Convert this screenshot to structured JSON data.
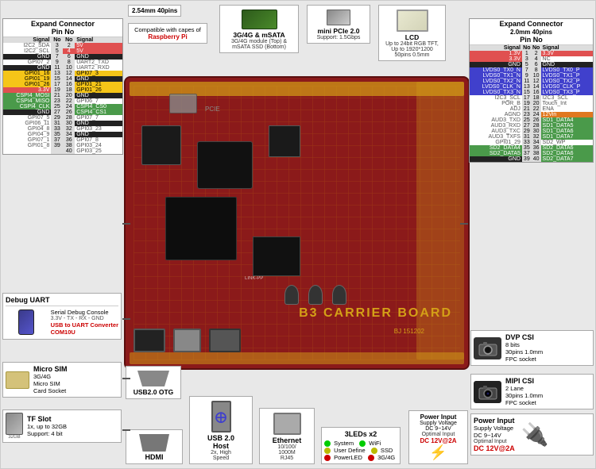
{
  "title": "B3 Carrier Board",
  "left_connector": {
    "title": "Expand Connector",
    "subtitle": "Pin No",
    "note": "2.54mm 40pins",
    "headers": [
      "",
      "",
      "",
      ""
    ],
    "pins": [
      {
        "left_signal": "I2C2_SDA",
        "left_num": "3",
        "right_num": "2",
        "right_signal": "5V",
        "left_color": "none",
        "right_color": "red"
      },
      {
        "left_signal": "I2C2_SCL",
        "left_num": "5",
        "right_num": "4",
        "right_signal": "5V",
        "left_color": "none",
        "right_color": "red"
      },
      {
        "left_signal": "GND",
        "left_num": "7",
        "right_num": "6",
        "right_signal": "GND",
        "left_color": "black",
        "right_color": "black"
      },
      {
        "left_signal": "GPI07_2",
        "left_num": "9",
        "right_num": "8",
        "right_signal": "UART2_TXD",
        "left_color": "none",
        "right_color": "none"
      },
      {
        "left_signal": "GND",
        "left_num": "11",
        "right_num": "10",
        "right_signal": "UART2_RXD",
        "left_color": "black",
        "right_color": "none"
      },
      {
        "left_signal": "GPI01_16",
        "left_num": "13",
        "right_num": "12",
        "right_signal": "GPI07_3",
        "left_color": "yellow",
        "right_color": "yellow"
      },
      {
        "left_signal": "GPI01_19",
        "left_num": "15",
        "right_num": "14",
        "right_signal": "GND",
        "left_color": "yellow",
        "right_color": "black"
      },
      {
        "left_signal": "GPI01_26",
        "left_num": "17",
        "right_num": "16",
        "right_signal": "GPI01_21",
        "left_color": "yellow",
        "right_color": "yellow"
      },
      {
        "left_signal": "3.3V",
        "left_num": "19",
        "right_num": "18",
        "right_signal": "GPI01_26",
        "left_color": "red",
        "right_color": "yellow"
      },
      {
        "left_signal": "CSPI4_MOSI",
        "left_num": "21",
        "right_num": "20",
        "right_signal": "GND",
        "left_color": "green",
        "right_color": "black"
      },
      {
        "left_signal": "CSPI4_MISO",
        "left_num": "23",
        "right_num": "22",
        "right_signal": "GPI06_7",
        "left_color": "green",
        "right_color": "none"
      },
      {
        "left_signal": "CSPI4_CLK",
        "left_num": "25",
        "right_num": "24",
        "right_signal": "CSPI4_CS0",
        "left_color": "green",
        "right_color": "green"
      },
      {
        "left_signal": "GND",
        "left_num": "27",
        "right_num": "26",
        "right_signal": "CSPI4_CS1",
        "left_color": "black",
        "right_color": "green"
      },
      {
        "left_signal": "GPI07_5",
        "left_num": "29",
        "right_num": "28",
        "right_signal": "GPI07_7",
        "left_color": "none",
        "right_color": "none"
      },
      {
        "left_signal": "GPI06_11",
        "left_num": "31",
        "right_num": "30",
        "right_signal": "GND",
        "left_color": "none",
        "right_color": "black"
      },
      {
        "left_signal": "GPI04_8",
        "left_num": "33",
        "right_num": "32",
        "right_signal": "GPI03_23",
        "left_color": "none",
        "right_color": "none"
      },
      {
        "left_signal": "GPI04_9",
        "left_num": "35",
        "right_num": "34",
        "right_signal": "GND",
        "left_color": "none",
        "right_color": "black"
      },
      {
        "left_signal": "GPI07_1",
        "left_num": "37",
        "right_num": "36",
        "right_signal": "GPI07_8",
        "left_color": "none",
        "right_color": "none"
      },
      {
        "left_signal": "GPI01_8",
        "left_num": "39",
        "right_num": "38",
        "right_signal": "GPI03_24",
        "left_color": "none",
        "right_color": "none"
      },
      {
        "left_signal": "",
        "left_num": "",
        "right_num": "40",
        "right_signal": "GPI03_25",
        "left_color": "none",
        "right_color": "none"
      }
    ]
  },
  "right_connector": {
    "title": "Expand Connector",
    "subtitle": "2.0mm 40pins",
    "subheader": "Pin No",
    "pins": [
      {
        "left_signal": "1.3V",
        "left_num": "1",
        "right_num": "2",
        "right_signal": "3.3V",
        "left_color": "red",
        "right_color": "red"
      },
      {
        "left_signal": "3.3V",
        "left_num": "3",
        "right_num": "4",
        "right_signal": "NC",
        "left_color": "red",
        "right_color": "none"
      },
      {
        "left_signal": "GND",
        "left_num": "5",
        "right_num": "6",
        "right_signal": "GND",
        "left_color": "black",
        "right_color": "black"
      },
      {
        "left_signal": "LVDS0_TX0_N",
        "left_num": "7",
        "right_num": "8",
        "right_signal": "LVDS0_TX0_P",
        "left_color": "blue",
        "right_color": "blue"
      },
      {
        "left_signal": "LVDS0_TX1_N",
        "left_num": "9",
        "right_num": "10",
        "right_signal": "LVDS0_TX1_P",
        "left_color": "blue",
        "right_color": "blue"
      },
      {
        "left_signal": "LVDS0_TX2_N",
        "left_num": "11",
        "right_num": "12",
        "right_signal": "LVDS0_TX2_P",
        "left_color": "blue",
        "right_color": "blue"
      },
      {
        "left_signal": "LVDS0_CLK_N",
        "left_num": "13",
        "right_num": "14",
        "right_signal": "LVDS0_CLK_P",
        "left_color": "blue",
        "right_color": "blue"
      },
      {
        "left_signal": "LVDS0_TX3_N",
        "left_num": "15",
        "right_num": "16",
        "right_signal": "LVDS0_TX3_P",
        "left_color": "blue",
        "right_color": "blue"
      },
      {
        "left_signal": "I2C3_SCL",
        "left_num": "17",
        "right_num": "18",
        "right_signal": "I2C3_SCL",
        "left_color": "none",
        "right_color": "none"
      },
      {
        "left_signal": "POR_B",
        "left_num": "19",
        "right_num": "20",
        "right_signal": "Touch_Int",
        "left_color": "none",
        "right_color": "none"
      },
      {
        "left_signal": "ADJ",
        "left_num": "21",
        "right_num": "22",
        "right_signal": "ENA",
        "left_color": "none",
        "right_color": "none"
      },
      {
        "left_signal": "AGND",
        "left_num": "23",
        "right_num": "24",
        "right_signal": "12Vin",
        "left_color": "none",
        "right_color": "orange"
      },
      {
        "left_signal": "AUD3_TXD",
        "left_num": "25",
        "right_num": "26",
        "right_signal": "SD1_DATA4",
        "left_color": "none",
        "right_color": "green"
      },
      {
        "left_signal": "AUD3_RXD",
        "left_num": "27",
        "right_num": "28",
        "right_signal": "SD1_DATA5",
        "left_color": "none",
        "right_color": "green"
      },
      {
        "left_signal": "AUD3_TXC",
        "left_num": "29",
        "right_num": "30",
        "right_signal": "SD1_DATA6",
        "left_color": "none",
        "right_color": "green"
      },
      {
        "left_signal": "AUD3_TXFS",
        "left_num": "31",
        "right_num": "32",
        "right_signal": "SD1_DATA7",
        "left_color": "none",
        "right_color": "green"
      },
      {
        "left_signal": "GPI01_29",
        "left_num": "33",
        "right_num": "34",
        "right_signal": "SD2_WP",
        "left_color": "none",
        "right_color": "none"
      },
      {
        "left_signal": "SD2_DATA4",
        "left_num": "35",
        "right_num": "36",
        "right_signal": "SD2_DATA6",
        "left_color": "green",
        "right_color": "green"
      },
      {
        "left_signal": "SD2_DATA5",
        "left_num": "37",
        "right_num": "38",
        "right_signal": "SD2_DATA6",
        "left_color": "green",
        "right_color": "green"
      },
      {
        "left_signal": "GND",
        "left_num": "39",
        "right_num": "40",
        "right_signal": "SD2_DATA7",
        "left_color": "black",
        "right_color": "green"
      }
    ]
  },
  "top_components": {
    "connector_note": "2.54mm 40pins",
    "raspberry_pi": {
      "note": "Compatible with capes of",
      "brand": "Raspberry Pi"
    },
    "ssd": {
      "title": "3G/4G & mSATA",
      "desc1": "3G/4G module (Top) &",
      "desc2": "mSATA SSD (Bottom)"
    },
    "mini_pcie": {
      "title": "mini PCIe 2.0",
      "desc": "Support: 1.5Gbps"
    },
    "lcd": {
      "title": "LCD",
      "desc1": "Up to 24bit RGB TFT,",
      "desc2": "Up to 1920*1200",
      "desc3": "50pins 0.5mm"
    }
  },
  "debug_uart": {
    "title": "Debug UART",
    "desc": "Serial Debug Console",
    "spec": "3.3V - TX - RX - GND",
    "link": "USB to UART Converter",
    "link2": "COM10U"
  },
  "micro_sim": {
    "title": "Micro SIM",
    "desc": "3G/4G",
    "desc2": "Micro SIM",
    "desc3": "Card Socket"
  },
  "tf_slot": {
    "title": "TF Slot",
    "desc": "1x, up to 32GB",
    "desc2": "Support: 4 bit"
  },
  "usb_otg": {
    "title": "USB2.0 OTG"
  },
  "hdmi": {
    "title": "HDMI"
  },
  "usb_host": {
    "title": "USB 2.0",
    "subtitle": "Host",
    "desc": "2x, High",
    "desc2": "Speed"
  },
  "ethernet": {
    "title": "Ethernet",
    "desc": "10/100/",
    "desc2": "1000M",
    "desc3": "RJ45"
  },
  "leds": {
    "title": "3LEDs x2",
    "led1": "System",
    "led1_color": "green",
    "led1_label": "WiFi",
    "led2": "User Define",
    "led2_color": "yellow",
    "led2_label": "SSD",
    "led3": "PowerLED",
    "led3_color": "red",
    "led3_label": "3G/4G"
  },
  "power_input": {
    "title": "Power Input",
    "desc": "Supply Voltage",
    "spec": "DC 9~14V",
    "optimal": "Optimal Input",
    "dc12v": "DC 12V@2A"
  },
  "dvp_csi": {
    "title": "DVP CSI",
    "desc": "8 bits",
    "desc2": "30pins 1.0mm",
    "desc3": "FPC socket"
  },
  "mipi_csi": {
    "title": "MIPI CSI",
    "desc": "2 Lane",
    "desc2": "30pins 1.0mm",
    "desc3": "FPC socket"
  },
  "board_label": "B3 CARRIER BOARD",
  "board_id": "BJ 151202"
}
